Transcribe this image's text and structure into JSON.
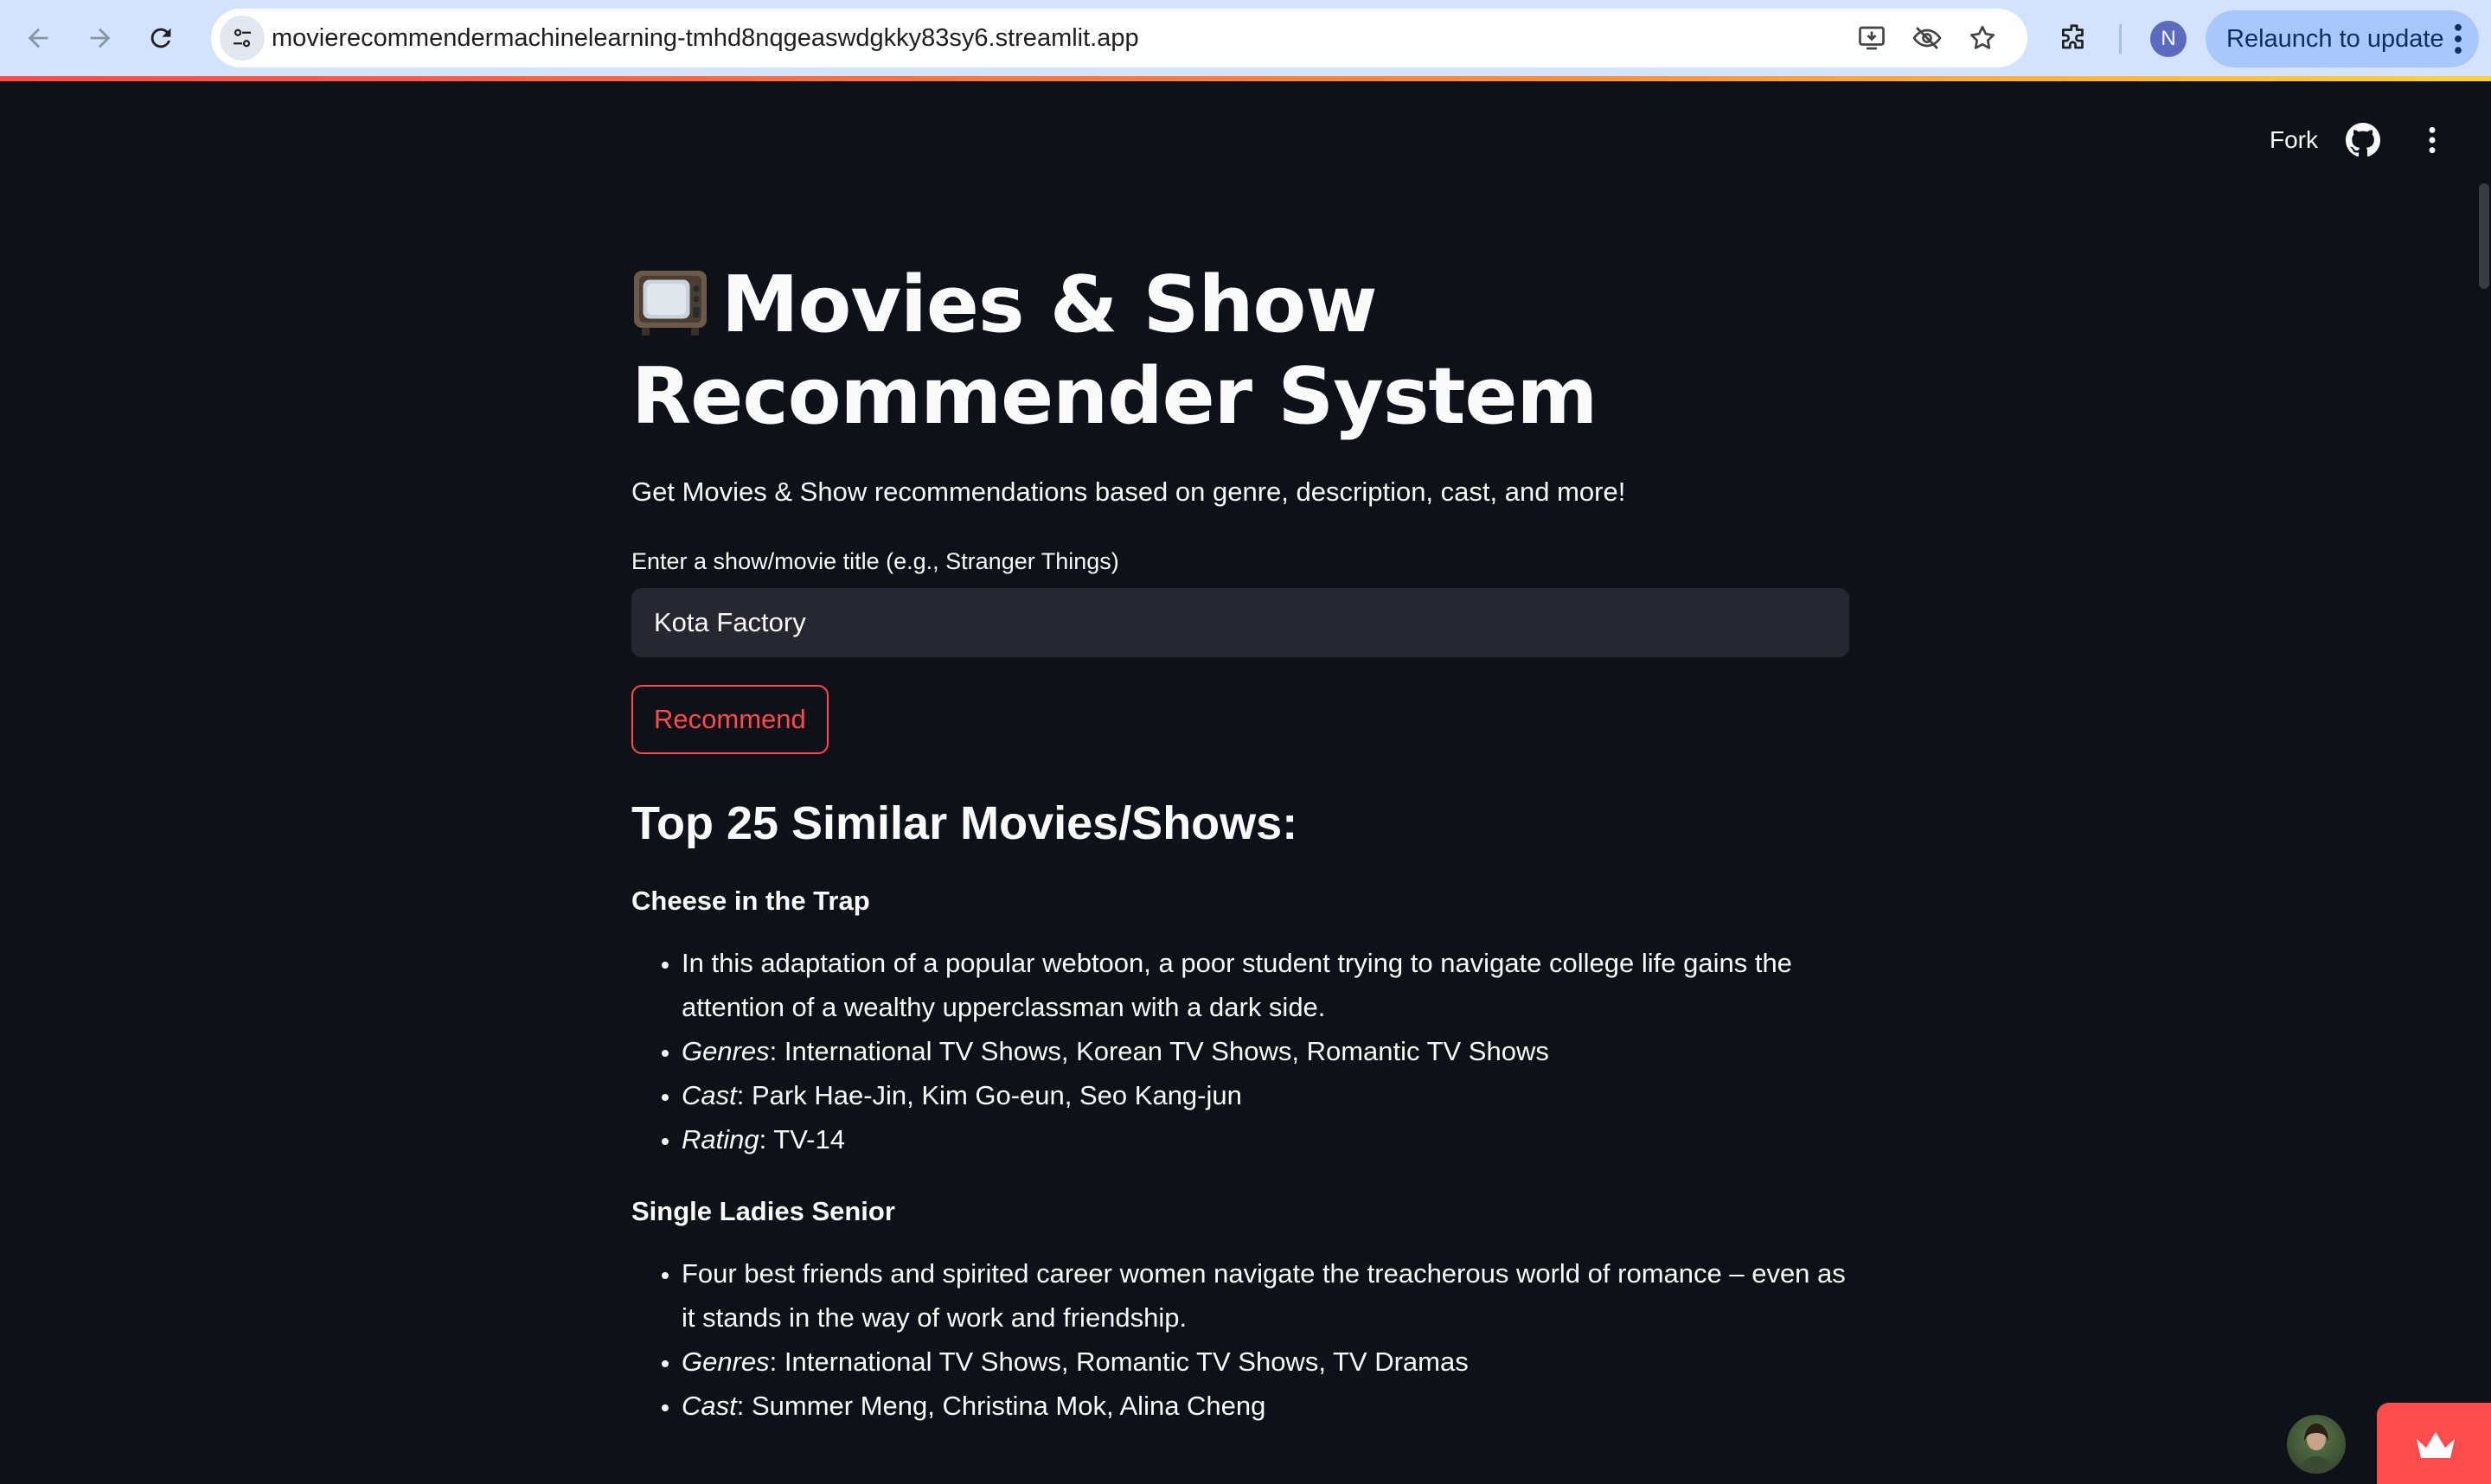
{
  "browser": {
    "url": "movierecommendermachinelearning-tmhd8nqgeaswdgkky83sy6.streamlit.app",
    "profile_initial": "N",
    "relaunch_label": "Relaunch to update"
  },
  "app_toolbar": {
    "fork_label": "Fork"
  },
  "page": {
    "title": "Movies & Show Recommender System",
    "title_icon": "tv-emoji",
    "subtitle": "Get Movies & Show recommendations based on genre, description, cast, and more!",
    "input_label": "Enter a show/movie title (e.g., Stranger Things)",
    "input_value": "Kota Factory",
    "button_label": "Recommend",
    "results_heading": "Top 25 Similar Movies/Shows:"
  },
  "field_labels": {
    "genres": "Genres",
    "cast": "Cast",
    "rating": "Rating"
  },
  "recommendations": [
    {
      "title": "Cheese in the Trap",
      "description": "In this adaptation of a popular webtoon, a poor student trying to navigate college life gains the attention of a wealthy upperclassman with a dark side.",
      "genres": ": International TV Shows, Korean TV Shows, Romantic TV Shows",
      "cast": ": Park Hae-Jin, Kim Go-eun, Seo Kang-jun",
      "rating": ": TV-14"
    },
    {
      "title": "Single Ladies Senior",
      "description": "Four best friends and spirited career women navigate the treacherous world of romance – even as it stands in the way of work and friendship.",
      "genres": ": International TV Shows, Romantic TV Shows, TV Dramas",
      "cast": ": Summer Meng, Christina Mok, Alina Cheng"
    }
  ],
  "colors": {
    "background": "#0e1117",
    "input_background": "#262730",
    "accent": "#ff4b4b",
    "text": "#fafafa",
    "browser_chrome": "#d3e3fd"
  }
}
